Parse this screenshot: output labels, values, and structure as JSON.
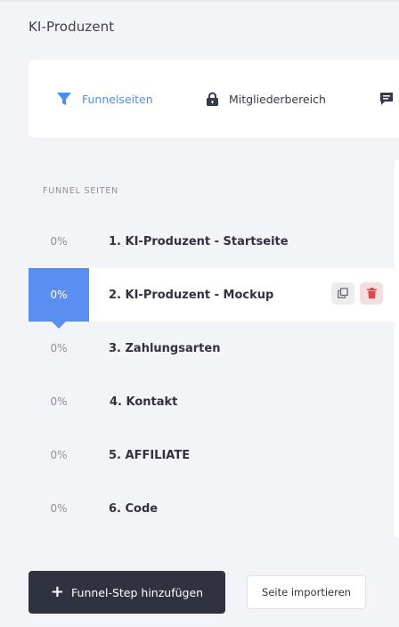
{
  "app": {
    "title": "KI-Produzent"
  },
  "tabs": [
    {
      "label": "Funnelseiten",
      "icon": "filter-icon",
      "active": true
    },
    {
      "label": "Mitgliederbereich",
      "icon": "lock-icon",
      "active": false
    },
    {
      "label": "",
      "icon": "comment-icon",
      "active": false
    }
  ],
  "steps_section": {
    "title": "FUNNEL SEITEN",
    "steps": [
      {
        "percent": "0%",
        "name": "1. KI-Produzent - Startseite",
        "active": false
      },
      {
        "percent": "0%",
        "name": "2. KI-Produzent - Mockup",
        "active": true
      },
      {
        "percent": "0%",
        "name": "3. Zahlungsarten",
        "active": false
      },
      {
        "percent": "0%",
        "name": "4. Kontakt",
        "active": false
      },
      {
        "percent": "0%",
        "name": "5. AFFILIATE",
        "active": false
      },
      {
        "percent": "0%",
        "name": "6. Code",
        "active": false
      }
    ],
    "row_actions": {
      "copy_icon": "copy-icon",
      "delete_icon": "trash-icon"
    }
  },
  "footer": {
    "add_step_label": "Funnel-Step hinzufügen",
    "import_label": "Seite importieren"
  },
  "colors": {
    "accent": "#5b8ef1",
    "dark_button": "#2f323f",
    "delete": "#e2474b"
  }
}
